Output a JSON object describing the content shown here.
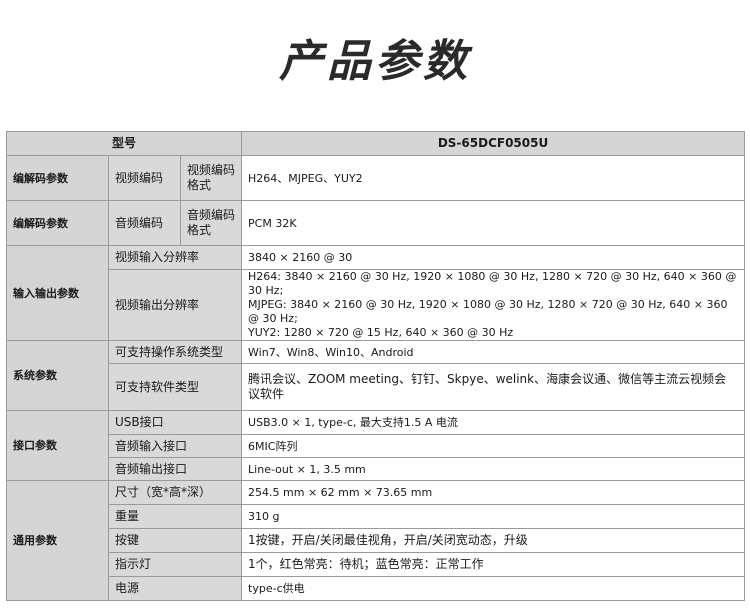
{
  "page_title": "产品参数",
  "header": {
    "label": "型号",
    "model": "DS-65DCF0505U"
  },
  "rows": {
    "codec_video": {
      "category": "编解码参数",
      "sub1": "视频编码",
      "sub2": "视频编码格式",
      "value": "H264、MJPEG、YUY2"
    },
    "codec_audio": {
      "category": "编解码参数",
      "sub1": "音频编码",
      "sub2": "音频编码格式",
      "value": "PCM 32K"
    },
    "io": {
      "category": "输入输出参数",
      "input_label": "视频输入分辨率",
      "input_value": "3840 × 2160 @ 30",
      "output_label": "视频输出分辨率",
      "output_lines": [
        "H264: 3840 × 2160 @ 30 Hz, 1920 × 1080 @ 30 Hz, 1280 × 720 @ 30 Hz, 640 × 360 @ 30 Hz;",
        "MJPEG: 3840 × 2160 @ 30 Hz, 1920 × 1080 @ 30 Hz, 1280 × 720 @ 30 Hz, 640 × 360 @ 30 Hz;",
        "YUY2: 1280 × 720 @ 15 Hz, 640 × 360 @ 30 Hz"
      ]
    },
    "system": {
      "category": "系统参数",
      "os_label": "可支持操作系统类型",
      "os_value": "Win7、Win8、Win10、Android",
      "sw_label": "可支持软件类型",
      "sw_value": "腾讯会议、ZOOM meeting、钉钉、Skpye、welink、海康会议通、微信等主流云视频会议软件"
    },
    "interface": {
      "category": "接口参数",
      "usb_label": "USB接口",
      "usb_value": "USB3.0 × 1, type-c, 最大支持1.5 A 电流",
      "audio_in_label": "音频输入接口",
      "audio_in_value": "6MIC阵列",
      "audio_out_label": "音频输出接口",
      "audio_out_value": "Line-out × 1, 3.5 mm"
    },
    "general": {
      "category": "通用参数",
      "size_label": "尺寸（宽*高*深）",
      "size_value": "254.5 mm × 62 mm × 73.65 mm",
      "weight_label": "重量",
      "weight_value": "310 g",
      "button_label": "按键",
      "button_value": "1按键，开启/关闭最佳视角，开启/关闭宽动态，升级",
      "led_label": "指示灯",
      "led_value": "1个，红色常亮：待机；蓝色常亮：正常工作",
      "power_label": "电源",
      "power_value": "type-c供电"
    }
  }
}
